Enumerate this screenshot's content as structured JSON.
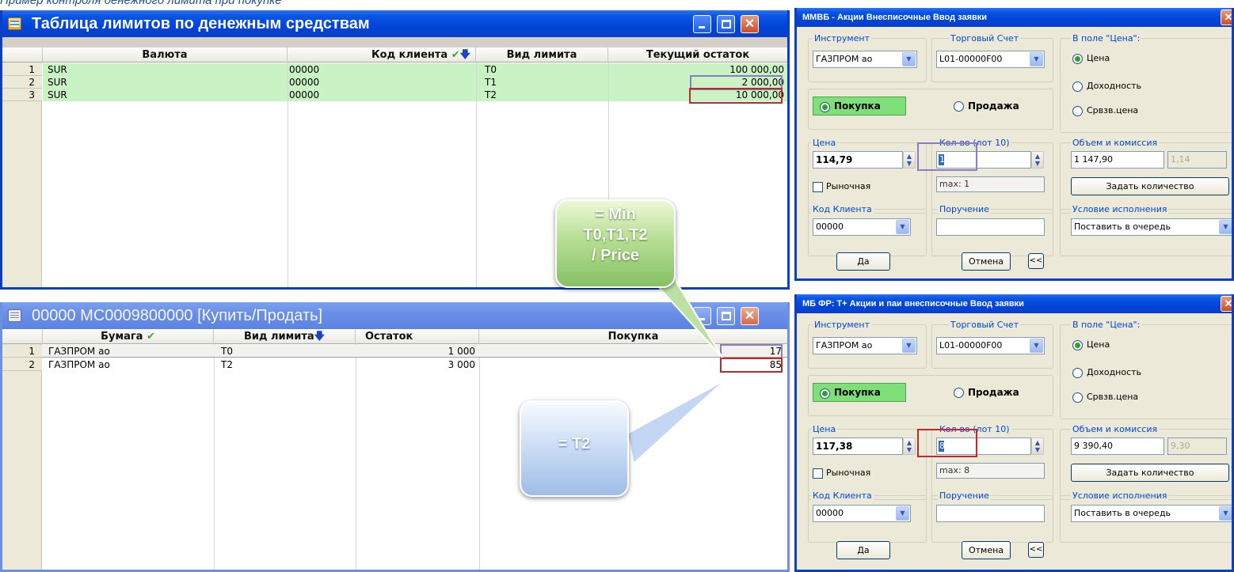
{
  "page_caption": "Пример контроля денежного лимита при покупке",
  "colors": {
    "highlight_purple": "#8e7cc3",
    "highlight_red": "#c0282a",
    "buy_green": "#7fe07a",
    "row_green": "#c9f3c4"
  },
  "limits_window": {
    "title": "Таблица лимитов по денежным средствам",
    "columns": [
      "Валюта",
      "Код клиента",
      "Вид лимита",
      "Текущий остаток"
    ],
    "rows": [
      {
        "num": "1",
        "currency": "SUR",
        "client": "00000",
        "limit": "T0",
        "balance": "100 000,00"
      },
      {
        "num": "2",
        "currency": "SUR",
        "client": "00000",
        "limit": "T1",
        "balance": "2 000,00"
      },
      {
        "num": "3",
        "currency": "SUR",
        "client": "00000",
        "limit": "T2",
        "balance": "10 000,00"
      }
    ]
  },
  "trade_window": {
    "title": "00000 MC0009800000 [Купить/Продать]",
    "columns": [
      "Бумага",
      "Вид лимита",
      "Остаток",
      "Покупка"
    ],
    "rows": [
      {
        "num": "1",
        "security": "ГАЗПРОМ ао",
        "limit": "T0",
        "remain": "1 000",
        "buy": "17"
      },
      {
        "num": "2",
        "security": "ГАЗПРОМ ао",
        "limit": "T2",
        "remain": "3 000",
        "buy": "85"
      }
    ]
  },
  "callouts": {
    "min": [
      "= Min",
      "T0,T1,T2",
      "/ Price"
    ],
    "t2": "= T2"
  },
  "dialogs": [
    {
      "title": "ММВБ - Акции Внесписочные Ввод заявки",
      "instrument_label": "Инструмент",
      "instrument": "ГАЗПРОМ ао",
      "account_label": "Торговый Счет",
      "account": "L01-00000F00",
      "price_field_label": "В поле \"Цена\":",
      "radio_price": "Цена",
      "radio_yield": "Доходность",
      "radio_wavg": "Срвзв.цена",
      "buy": "Покупка",
      "sell": "Продажа",
      "price_label": "Цена",
      "price": "114,79",
      "qty_label": "Кол-во (лот 10)",
      "qty": "1",
      "qty_max": "max: 1",
      "volume_label": "Объем  и комиссия",
      "volume": "1 147,90",
      "commission": "1,14",
      "market": "Рыночная",
      "set_qty": "Задать количество",
      "client_label": "Код Клиента",
      "client": "00000",
      "order_label": "Поручение",
      "condition_label": "Условие исполнения",
      "condition": "Поставить в очередь",
      "ok": "Да",
      "cancel": "Отмена",
      "collapse": "<<"
    },
    {
      "title": "МБ ФР: Т+ Акции и паи внесписочные Ввод заявки",
      "instrument_label": "Инструмент",
      "instrument": "ГАЗПРОМ ао",
      "account_label": "Торговый Счет",
      "account": "L01-00000F00",
      "price_field_label": "В поле \"Цена\":",
      "radio_price": "Цена",
      "radio_yield": "Доходность",
      "radio_wavg": "Срвзв.цена",
      "buy": "Покупка",
      "sell": "Продажа",
      "price_label": "Цена",
      "price": "117,38",
      "qty_label": "Кол-во (лот 10)",
      "qty": "8",
      "qty_max": "max: 8",
      "volume_label": "Объем  и комиссия",
      "volume": "9 390,40",
      "commission": "9,30",
      "market": "Рыночная",
      "set_qty": "Задать количество",
      "client_label": "Код Клиента",
      "client": "00000",
      "order_label": "Поручение",
      "condition_label": "Условие исполнения",
      "condition": "Поставить в очередь",
      "ok": "Да",
      "cancel": "Отмена",
      "collapse": "<<"
    }
  ]
}
